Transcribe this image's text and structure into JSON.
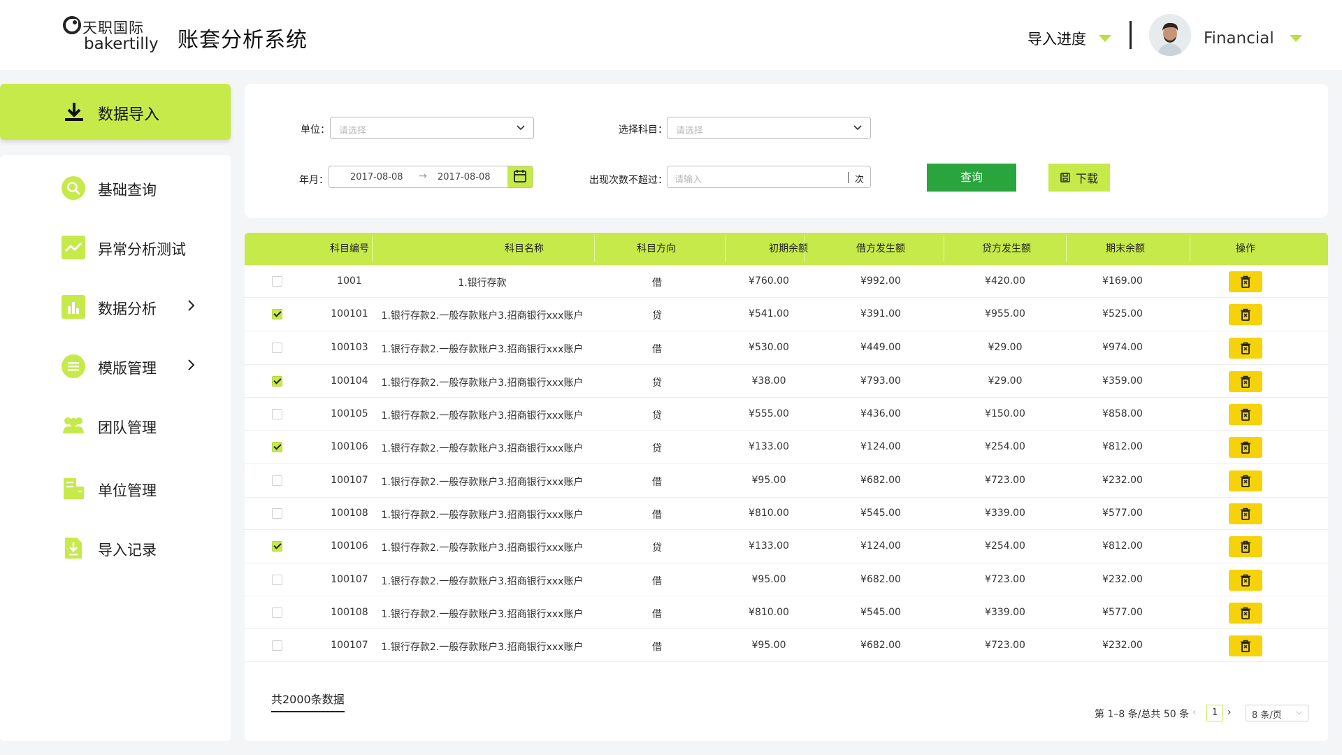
{
  "header": {
    "logo_cn": "天职国际",
    "logo_en": "bakertilly",
    "app_title": "账套分析系统",
    "import_progress": "导入进度",
    "user_name": "Financial"
  },
  "sidebar": {
    "active": {
      "label": "数据导入",
      "icon": "download-icon"
    },
    "items": [
      {
        "label": "基础查询",
        "icon": "search-icon",
        "has_submenu": false
      },
      {
        "label": "异常分析测试",
        "icon": "trend-icon",
        "has_submenu": false
      },
      {
        "label": "数据分析",
        "icon": "bar-chart-icon",
        "has_submenu": true
      },
      {
        "label": "模版管理",
        "icon": "list-icon",
        "has_submenu": true
      },
      {
        "label": "团队管理",
        "icon": "team-icon",
        "has_submenu": false
      },
      {
        "label": "单位管理",
        "icon": "building-icon",
        "has_submenu": false
      },
      {
        "label": "导入记录",
        "icon": "import-record-icon",
        "has_submenu": false
      }
    ]
  },
  "filters": {
    "unit_label": "单位：",
    "unit_placeholder": "请选择",
    "subject_label": "选择科目：",
    "subject_placeholder": "请选择",
    "date_label": "年月：",
    "date_start": "2017-08-08",
    "date_end": "2017-08-08",
    "count_label": "出现次数不超过：",
    "count_placeholder": "请输入",
    "count_unit": "次",
    "query_button": "查询",
    "download_button": "下载"
  },
  "table": {
    "columns": [
      "科目编号",
      "科目名称",
      "科目方向",
      "初期余额",
      "借方发生额",
      "贷方发生额",
      "期末余额",
      "操作"
    ],
    "rows": [
      {
        "checked": false,
        "code": "1001",
        "name": "1.银行存款",
        "direction": "借",
        "opening": "¥760.00",
        "debit": "¥992.00",
        "credit": "¥420.00",
        "closing": "¥169.00"
      },
      {
        "checked": true,
        "code": "100101",
        "name": "1.银行存款2.一般存款账户3.招商银行xxx账户",
        "direction": "贷",
        "opening": "¥541.00",
        "debit": "¥391.00",
        "credit": "¥955.00",
        "closing": "¥525.00"
      },
      {
        "checked": false,
        "code": "100103",
        "name": "1.银行存款2.一般存款账户3.招商银行xxx账户",
        "direction": "借",
        "opening": "¥530.00",
        "debit": "¥449.00",
        "credit": "¥29.00",
        "closing": "¥974.00"
      },
      {
        "checked": true,
        "code": "100104",
        "name": "1.银行存款2.一般存款账户3.招商银行xxx账户",
        "direction": "贷",
        "opening": "¥38.00",
        "debit": "¥793.00",
        "credit": "¥29.00",
        "closing": "¥359.00"
      },
      {
        "checked": false,
        "code": "100105",
        "name": "1.银行存款2.一般存款账户3.招商银行xxx账户",
        "direction": "贷",
        "opening": "¥555.00",
        "debit": "¥436.00",
        "credit": "¥150.00",
        "closing": "¥858.00"
      },
      {
        "checked": true,
        "code": "100106",
        "name": "1.银行存款2.一般存款账户3.招商银行xxx账户",
        "direction": "贷",
        "opening": "¥133.00",
        "debit": "¥124.00",
        "credit": "¥254.00",
        "closing": "¥812.00"
      },
      {
        "checked": false,
        "code": "100107",
        "name": "1.银行存款2.一般存款账户3.招商银行xxx账户",
        "direction": "借",
        "opening": "¥95.00",
        "debit": "¥682.00",
        "credit": "¥723.00",
        "closing": "¥232.00"
      },
      {
        "checked": false,
        "code": "100108",
        "name": "1.银行存款2.一般存款账户3.招商银行xxx账户",
        "direction": "借",
        "opening": "¥810.00",
        "debit": "¥545.00",
        "credit": "¥339.00",
        "closing": "¥577.00"
      },
      {
        "checked": true,
        "code": "100106",
        "name": "1.银行存款2.一般存款账户3.招商银行xxx账户",
        "direction": "贷",
        "opening": "¥133.00",
        "debit": "¥124.00",
        "credit": "¥254.00",
        "closing": "¥812.00"
      },
      {
        "checked": false,
        "code": "100107",
        "name": "1.银行存款2.一般存款账户3.招商银行xxx账户",
        "direction": "借",
        "opening": "¥95.00",
        "debit": "¥682.00",
        "credit": "¥723.00",
        "closing": "¥232.00"
      },
      {
        "checked": false,
        "code": "100108",
        "name": "1.银行存款2.一般存款账户3.招商银行xxx账户",
        "direction": "借",
        "opening": "¥810.00",
        "debit": "¥545.00",
        "credit": "¥339.00",
        "closing": "¥577.00"
      },
      {
        "checked": false,
        "code": "100107",
        "name": "1.银行存款2.一般存款账户3.招商银行xxx账户",
        "direction": "借",
        "opening": "¥95.00",
        "debit": "¥682.00",
        "credit": "¥723.00",
        "closing": "¥232.00"
      }
    ],
    "row_action_icon": "delete-icon"
  },
  "footer": {
    "total": "共2000条数据",
    "page_info": "第 1–8 条/总共 50 条",
    "current_page": "1",
    "page_size": "8 条/页"
  },
  "colors": {
    "accent": "#c6ea4a",
    "query_button": "#2aa43c",
    "action_button": "#f6d20a"
  }
}
